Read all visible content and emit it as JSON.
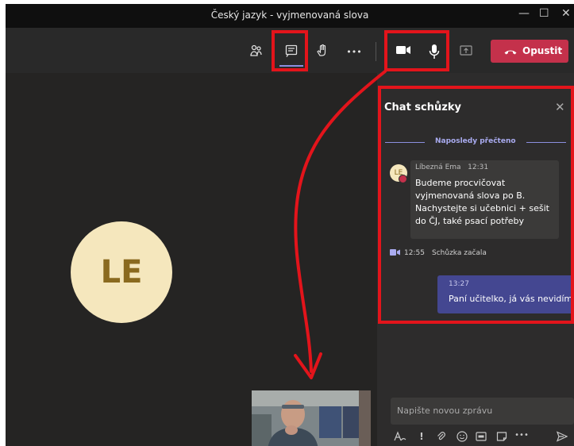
{
  "window": {
    "title": "Český jazyk - vyjmenovaná slova",
    "controls": {
      "minimize": "—",
      "maximize": "☐",
      "close": "✕"
    }
  },
  "toolbar": {
    "icons": [
      "participants-icon",
      "chat-icon",
      "raise-hand-icon",
      "more-icon",
      "camera-icon",
      "microphone-icon",
      "share-icon"
    ],
    "more_glyph": "•••",
    "leave_label": "Opustit"
  },
  "stage": {
    "participant_initials": "LE"
  },
  "chat": {
    "title": "Chat schůzky",
    "close_glyph": "✕",
    "last_read": "Naposledy přečteno",
    "messages": [
      {
        "avatar": "LE",
        "author": "Líbezná Ema",
        "time": "12:31",
        "text": "Budeme procvičovat vyjmenovaná slova po B. Nachystejte si učebnici + sešit do ČJ, také psací potřeby"
      }
    ],
    "system": {
      "time": "12:55",
      "text": "Schůzka začala"
    },
    "own_message": {
      "time": "13:27",
      "text": "Paní učitelko, já vás nevidím."
    },
    "input_placeholder": "Napište novou zprávu",
    "compose_tools": [
      "format-icon",
      "important-icon",
      "attach-icon",
      "emoji-icon",
      "gif-icon",
      "sticker-icon",
      "more-icon",
      "send-icon"
    ]
  },
  "colors": {
    "leave": "#c4314b",
    "accent": "#8b8fe0",
    "own_bubble": "#444791",
    "annotation": "#e3141b"
  }
}
